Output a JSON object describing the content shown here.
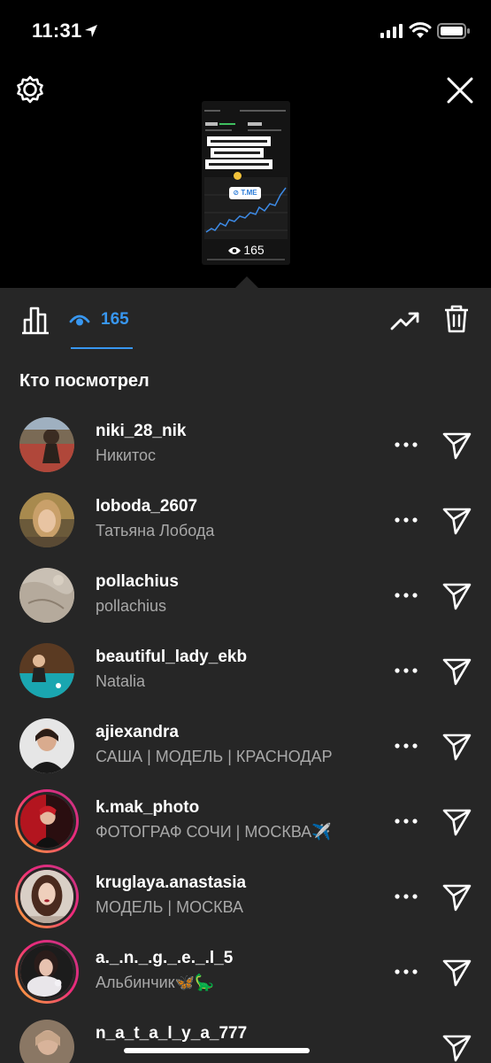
{
  "status_bar": {
    "time": "11:31"
  },
  "story_preview": {
    "link_label": "T.ME",
    "views": "165"
  },
  "tabs": {
    "views_count": "165"
  },
  "section_title": "Кто посмотрел",
  "viewers": [
    {
      "username": "niki_28_nik",
      "full_name": "Никитос",
      "story_ring": false
    },
    {
      "username": "loboda_2607",
      "full_name": "Татьяна Лобода",
      "story_ring": false
    },
    {
      "username": "pollachius",
      "full_name": "pollachius",
      "story_ring": false
    },
    {
      "username": "beautiful_lady_ekb",
      "full_name": "Natalia",
      "story_ring": false
    },
    {
      "username": "ajiexandra",
      "full_name": "САША | МОДЕЛЬ | КРАСНОДАР",
      "story_ring": false
    },
    {
      "username": "k.mak_photo",
      "full_name": "ФОТОГРАФ СОЧИ | МОСКВА✈️",
      "story_ring": true
    },
    {
      "username": "kruglaya.anastasia",
      "full_name": "МОДЕЛЬ | МОСКВА",
      "story_ring": true
    },
    {
      "username": "a._.n._.g._.e._.l_5",
      "full_name": "Альбинчик🦋🦕",
      "story_ring": true
    },
    {
      "username": "n_a_t_a_l_y_a_777",
      "full_name": "",
      "story_ring": false
    }
  ],
  "icons": {
    "settings": "gear-icon",
    "close": "close-icon",
    "insights": "bar-chart-icon",
    "views": "eye-icon",
    "promote": "trending-up-icon",
    "delete": "trash-icon",
    "more": "more-icon",
    "send": "paper-plane-icon"
  },
  "colors": {
    "accent": "#3897f0",
    "panel_bg": "#262626",
    "secondary_text": "#a8a8a8"
  }
}
